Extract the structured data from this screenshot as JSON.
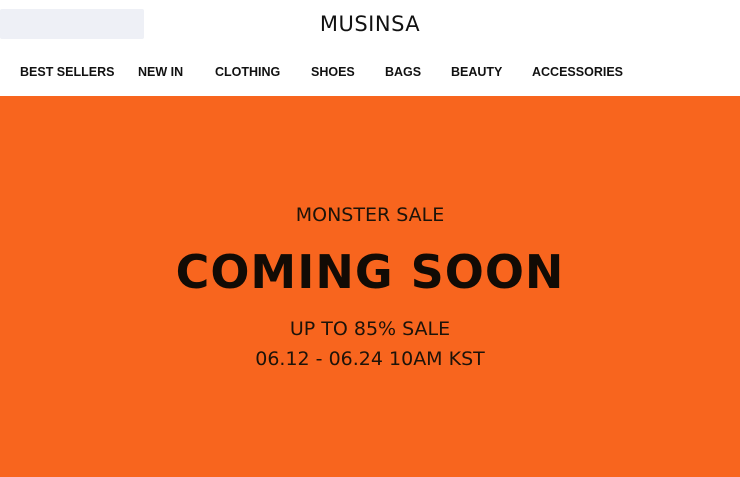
{
  "header": {
    "logo": "MUSINSA"
  },
  "nav": {
    "items": [
      {
        "label": "BEST SELLERS"
      },
      {
        "label": "NEW IN"
      },
      {
        "label": "CLOTHING"
      },
      {
        "label": "SHOES"
      },
      {
        "label": "BAGS"
      },
      {
        "label": "BEAUTY"
      },
      {
        "label": "ACCESSORIES"
      }
    ]
  },
  "banner": {
    "eyebrow": "MONSTER SALE",
    "title": "COMING SOON",
    "subtitle": "UP TO 85% SALE",
    "dates": "06.12 - 06.24 10AM KST",
    "background_color": "#f8651e"
  }
}
